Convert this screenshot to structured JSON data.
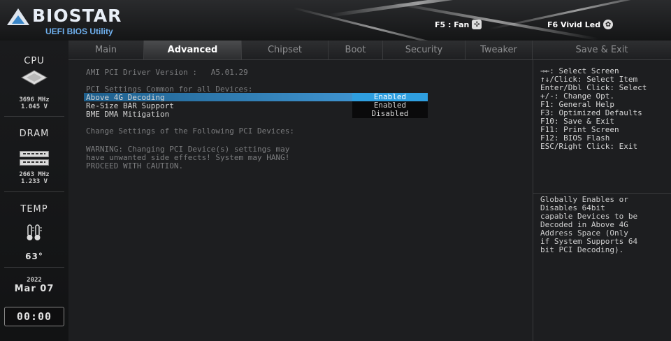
{
  "header": {
    "brand": "BIOSTAR",
    "subtitle": "UEFI BIOS Utility",
    "f5_label": "F5 : Fan",
    "f6_label": "F6  Vivid Led"
  },
  "sidebar": {
    "cpu": {
      "title": "CPU",
      "freq": "3696 MHz",
      "volt": "1.045 V"
    },
    "dram": {
      "title": "DRAM",
      "freq": "2663 MHz",
      "volt": "1.233 V"
    },
    "temp": {
      "title": "TEMP",
      "value": "63°"
    },
    "date": {
      "year": "2022",
      "day": "Mar 07"
    },
    "clock": "00:00"
  },
  "tabs": [
    "Main",
    "Advanced",
    "Chipset",
    "Boot",
    "Security",
    "Tweaker",
    "Save & Exit"
  ],
  "active_tab": "Advanced",
  "main": {
    "driver_version": "AMI PCI Driver Version :   A5.01.29",
    "section_title": "PCI Settings Common for all Devices:",
    "items": [
      {
        "label": "Above 4G Decoding",
        "value": "Enabled",
        "selected": true
      },
      {
        "label": "Re-Size BAR Support",
        "value": "Enabled",
        "selected": false
      },
      {
        "label": "BME DMA Mitigation",
        "value": "Disabled",
        "selected": false
      }
    ],
    "change_text": "Change Settings of the Following PCI Devices:",
    "warning": [
      "WARNING: Changing PCI Device(s) settings may",
      "have unwanted side effects! System may HANG!",
      "PROCEED WITH CAUTION."
    ]
  },
  "help": [
    "→←: Select Screen",
    "↑↓/Click: Select Item",
    "Enter/Dbl Click: Select",
    "+/-: Change Opt.",
    "F1: General Help",
    "F3: Optimized Defaults",
    "F10: Save & Exit",
    "F11: Print Screen",
    "F12: BIOS Flash",
    "ESC/Right Click: Exit"
  ],
  "description": [
    "Globally Enables or",
    "Disables 64bit",
    "capable Devices to be",
    "Decoded in Above 4G",
    "Address Space (Only",
    "if System Supports 64",
    "bit PCI Decoding)."
  ],
  "colors": {
    "accent": "#2f9fe0",
    "highlight": "#1e5f8c"
  }
}
